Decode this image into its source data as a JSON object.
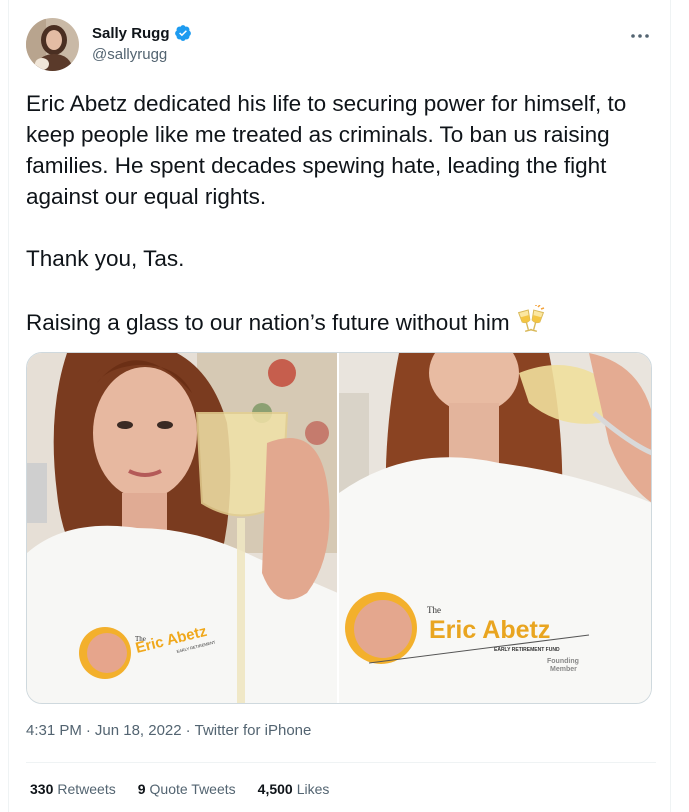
{
  "author": {
    "display_name": "Sally Rugg",
    "handle": "@sallyrugg",
    "verified": true
  },
  "tweet": {
    "paragraphs": [
      "Eric Abetz dedicated his life to securing power for himself, to keep people like me treated as criminals. To ban us raising families. He spent decades spewing hate, leading the fight against our equal rights.",
      "Thank you, Tas.",
      "Raising a glass to our nation’s future without him"
    ],
    "emoji": "clinking-glasses"
  },
  "media": {
    "left_shirt": {
      "the": "The",
      "brand": "Eric Abetz",
      "sub": "EARLY RETIREMENT"
    },
    "right_shirt": {
      "the": "The",
      "brand": "Eric Abetz",
      "sub": "EARLY RETIREMENT FUND",
      "badge_line1": "Founding",
      "badge_line2": "Member"
    }
  },
  "meta": {
    "time": "4:31 PM",
    "separator": "·",
    "date": "Jun 18, 2022",
    "source": "Twitter for iPhone"
  },
  "stats": {
    "retweets_count": "330",
    "retweets_label": "Retweets",
    "quotes_count": "9",
    "quotes_label": "Quote Tweets",
    "likes_count": "4,500",
    "likes_label": "Likes"
  },
  "colors": {
    "verified": "#1d9bf0",
    "text": "#0f1419",
    "secondary": "#536471",
    "border": "#cfd9de"
  }
}
